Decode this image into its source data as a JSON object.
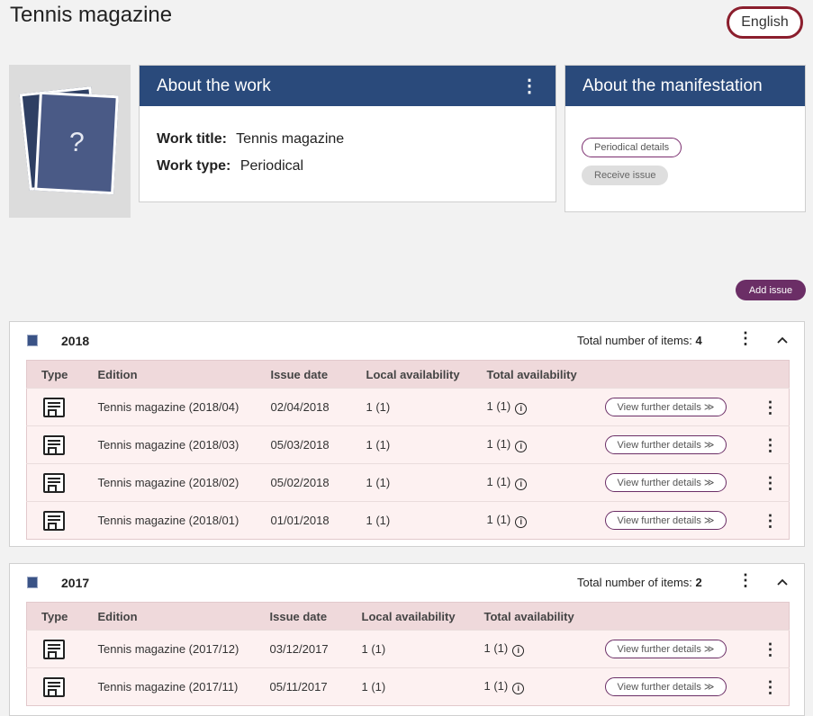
{
  "page": {
    "title": "Tennis magazine",
    "language": "English"
  },
  "cover": {
    "placeholder_glyph": "?"
  },
  "about_work": {
    "header": "About the work",
    "title_label": "Work title:",
    "title_value": "Tennis magazine",
    "type_label": "Work type:",
    "type_value": "Periodical"
  },
  "about_manifestation": {
    "header": "About the manifestation",
    "periodical_details": "Periodical details",
    "receive_issue": "Receive issue"
  },
  "add_issue": "Add issue",
  "columns": [
    "Type",
    "Edition",
    "Issue date",
    "Local availability",
    "Total availability"
  ],
  "details_label": "View further details ≫",
  "years": [
    {
      "year": "2018",
      "total_label": "Total number of items:",
      "total_count": "4",
      "rows": [
        {
          "edition": "Tennis magazine (2018/04)",
          "date": "02/04/2018",
          "local": "1 (1)",
          "total": "1 (1)"
        },
        {
          "edition": "Tennis magazine (2018/03)",
          "date": "05/03/2018",
          "local": "1 (1)",
          "total": "1 (1)"
        },
        {
          "edition": "Tennis magazine (2018/02)",
          "date": "05/02/2018",
          "local": "1 (1)",
          "total": "1 (1)"
        },
        {
          "edition": "Tennis magazine (2018/01)",
          "date": "01/01/2018",
          "local": "1 (1)",
          "total": "1 (1)"
        }
      ]
    },
    {
      "year": "2017",
      "total_label": "Total number of items:",
      "total_count": "2",
      "rows": [
        {
          "edition": "Tennis magazine (2017/12)",
          "date": "03/12/2017",
          "local": "1 (1)",
          "total": "1 (1)"
        },
        {
          "edition": "Tennis magazine (2017/11)",
          "date": "05/11/2017",
          "local": "1 (1)",
          "total": "1 (1)"
        }
      ]
    }
  ],
  "colors": {
    "header_blue": "#2a4a7b",
    "accent_purple": "#6b2e66",
    "language_border": "#8b1e2d",
    "row_pink": "#fdf1f1"
  },
  "icons": {
    "kebab": "⋮",
    "chevron_up": "︿",
    "info": "i"
  }
}
